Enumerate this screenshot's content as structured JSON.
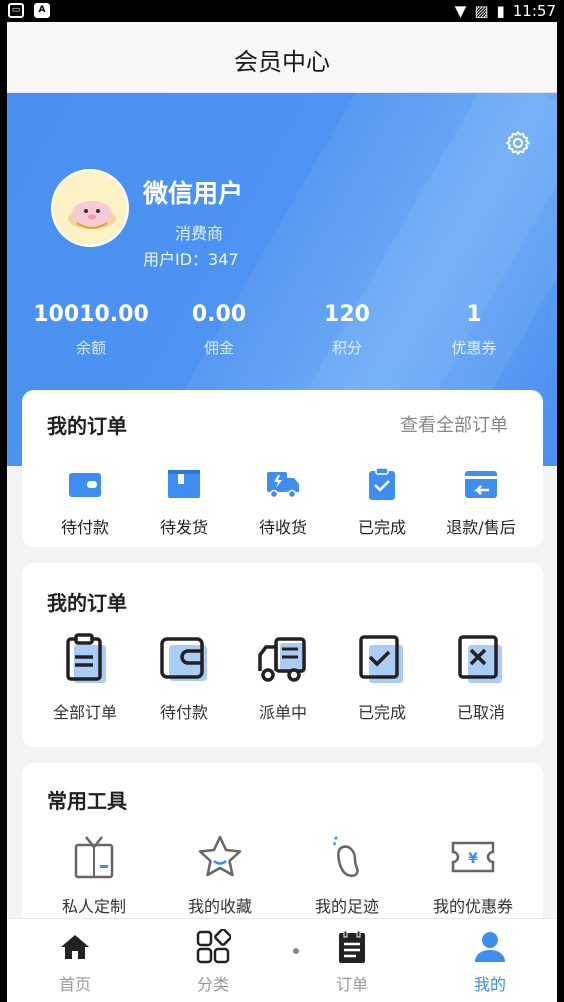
{
  "status_bar": {
    "time": "11:57",
    "app_icon_a": "A"
  },
  "header": {
    "title": "会员中心"
  },
  "profile": {
    "nickname": "微信用户",
    "role": "消费商",
    "user_id": "用户ID：347"
  },
  "stats": [
    {
      "value": "10010.00",
      "label": "余额"
    },
    {
      "value": "0.00",
      "label": "佣金"
    },
    {
      "value": "120",
      "label": "积分"
    },
    {
      "value": "1",
      "label": "优惠券"
    }
  ],
  "orders_card": {
    "title": "我的订单",
    "more": "查看全部订单",
    "items": [
      {
        "label": "待付款",
        "icon": "wallet-icon"
      },
      {
        "label": "待发货",
        "icon": "package-icon"
      },
      {
        "label": "待收货",
        "icon": "truck-icon"
      },
      {
        "label": "已完成",
        "icon": "clipboard-check-icon"
      },
      {
        "label": "退款/售后",
        "icon": "refund-icon"
      }
    ]
  },
  "orders_card2": {
    "title": "我的订单",
    "items": [
      {
        "label": "全部订单",
        "icon": "clipboard-icon"
      },
      {
        "label": "待付款",
        "icon": "wallet-icon"
      },
      {
        "label": "派单中",
        "icon": "delivery-truck-icon"
      },
      {
        "label": "已完成",
        "icon": "checkbox-icon"
      },
      {
        "label": "已取消",
        "icon": "cancel-box-icon"
      }
    ]
  },
  "tools_card": {
    "title": "常用工具",
    "items": [
      {
        "label": "私人定制",
        "icon": "suit-icon"
      },
      {
        "label": "我的收藏",
        "icon": "star-icon"
      },
      {
        "label": "我的足迹",
        "icon": "footprint-icon"
      },
      {
        "label": "我的优惠券",
        "icon": "coupon-icon"
      }
    ]
  },
  "tabbar": [
    {
      "label": "首页",
      "icon": "home-icon"
    },
    {
      "label": "分类",
      "icon": "category-icon"
    },
    {
      "label": "订单",
      "icon": "order-icon"
    },
    {
      "label": "我的",
      "icon": "user-icon"
    }
  ],
  "colors": {
    "accent": "#3d8ef0",
    "hero": "#4a90f0",
    "icon_light": "#a9cdf5"
  }
}
